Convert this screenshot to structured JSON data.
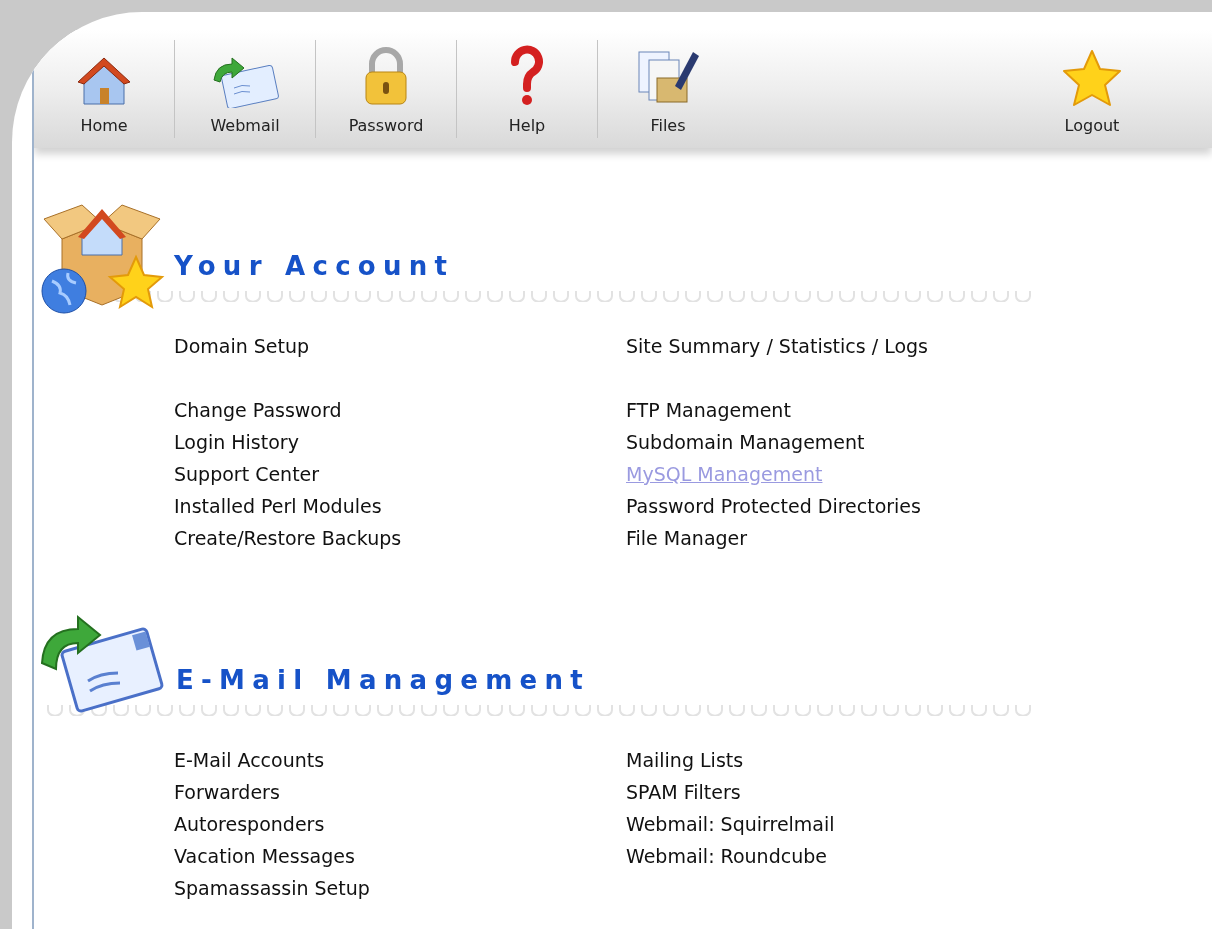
{
  "toolbar": {
    "items": [
      {
        "label": "Home",
        "kind": "house"
      },
      {
        "label": "Webmail",
        "kind": "mail"
      },
      {
        "label": "Password",
        "kind": "lock"
      },
      {
        "label": "Help",
        "kind": "help"
      },
      {
        "label": "Files",
        "kind": "files"
      }
    ],
    "right_items": [
      {
        "label": "Logout",
        "kind": "star"
      }
    ]
  },
  "sections": [
    {
      "title": "Your Account",
      "kind": "account",
      "columns": [
        [
          [
            "Domain Setup"
          ],
          [
            "Change Password",
            "Login History",
            "Support Center",
            "Installed Perl Modules",
            "Create/Restore Backups"
          ]
        ],
        [
          [
            "Site Summary / Statistics / Logs"
          ],
          [
            "FTP Management",
            "Subdomain Management",
            {
              "label": "MySQL Management",
              "visited": true
            },
            "Password Protected Directories",
            "File Manager"
          ]
        ]
      ]
    },
    {
      "title": "E-Mail Management",
      "kind": "email",
      "columns": [
        [
          [
            "E-Mail Accounts",
            "Forwarders",
            "Autoresponders",
            "Vacation Messages",
            "Spamassassin Setup"
          ]
        ],
        [
          [
            "Mailing Lists",
            "SPAM Filters",
            "Webmail: Squirrelmail",
            "Webmail: Roundcube"
          ]
        ]
      ]
    }
  ]
}
